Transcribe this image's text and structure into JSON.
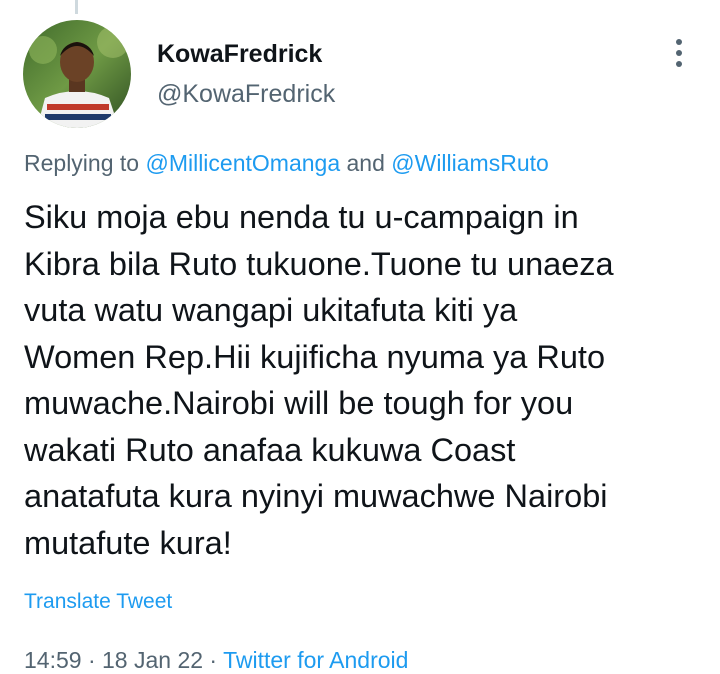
{
  "user": {
    "display_name": "KowaFredrick",
    "handle": "@KowaFredrick"
  },
  "reply": {
    "prefix": "Replying to ",
    "mention_1": "@MillicentOmanga",
    "connector": " and ",
    "mention_2": "@WilliamsRuto"
  },
  "tweet": {
    "text": "Siku moja ebu nenda tu u-campaign in\nKibra bila Ruto tukuone.Tuone tu unaeza\nvuta watu wangapi ukitafuta kiti ya\nWomen Rep.Hii kujificha nyuma ya Ruto\nmuwache.Nairobi will be tough for you\nwakati Ruto anafaa kukuwa Coast\nanatafuta kura nyinyi muwachwe Nairobi\nmutafute kura!",
    "translate_label": "Translate Tweet"
  },
  "meta": {
    "time": "14:59",
    "separator": " · ",
    "date": "18 Jan 22",
    "source": "Twitter for Android"
  },
  "icons": {
    "more": "more-vertical-icon",
    "avatar": "user-avatar-photo"
  },
  "colors": {
    "link": "#1d9bf0",
    "secondary_text": "#536471",
    "primary_text": "#0f1419"
  }
}
